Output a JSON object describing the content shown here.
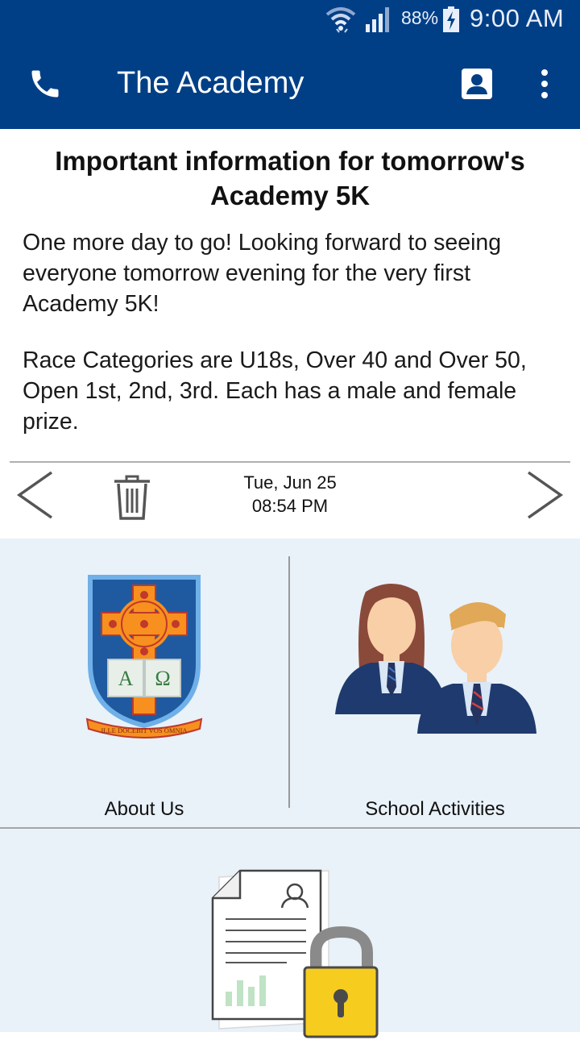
{
  "status_bar": {
    "battery_percent": "88%",
    "time": "9:00 AM",
    "icons": [
      "wifi-icon",
      "signal-icon",
      "battery-charging-icon"
    ]
  },
  "app_bar": {
    "title": "The Academy",
    "icons": [
      "phone-icon",
      "contact-card-icon",
      "more-vert-icon"
    ]
  },
  "message": {
    "title": "Important information for tomorrow's Academy 5K",
    "paragraphs": [
      "One more day to go! Looking forward to seeing everyone tomorrow evening for the very first Academy 5K!",
      "Race Categories are U18s, Over 40 and Over 50, Open 1st, 2nd, 3rd. Each has a male and female prize."
    ],
    "date": "Tue, Jun 25",
    "time": "08:54 PM"
  },
  "tiles": [
    {
      "label": "About Us",
      "icon": "school-crest-icon"
    },
    {
      "label": "School Activities",
      "icon": "students-icon"
    },
    {
      "label": "",
      "icon": "secure-document-icon"
    }
  ],
  "crest": {
    "letters": "Α Ω",
    "motto": "ILLE DOCEBIT VOS OMNIA"
  },
  "colors": {
    "primary": "#003f86",
    "tile_background": "#e9f1f9"
  }
}
